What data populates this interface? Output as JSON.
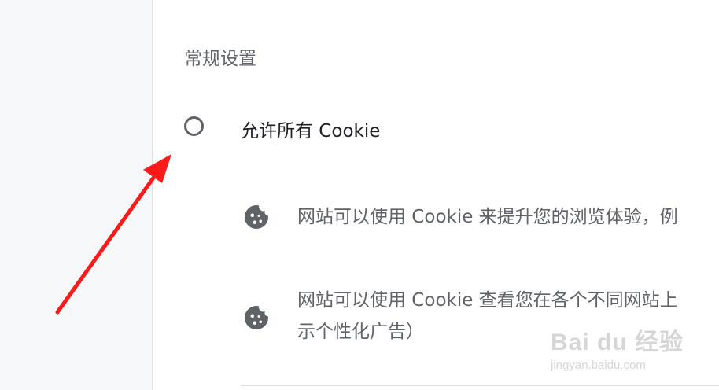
{
  "section": {
    "title": "常规设置"
  },
  "option": {
    "label": "允许所有 Cookie"
  },
  "descriptions": [
    {
      "lines": [
        "网站可以使用 Cookie 来提升您的浏览体验，例"
      ],
      "icon": "cookie-icon"
    },
    {
      "lines": [
        "网站可以使用 Cookie 查看您在各个不同网站上",
        "示个性化广告）"
      ],
      "icon": "cookie-icon"
    }
  ],
  "colors": {
    "annotation_arrow": "#ff1a1a",
    "text_secondary": "#5f6368",
    "text_primary": "#202124"
  },
  "watermark": {
    "main": "Bai du 经验",
    "sub": "jingyan.baidu.com"
  }
}
